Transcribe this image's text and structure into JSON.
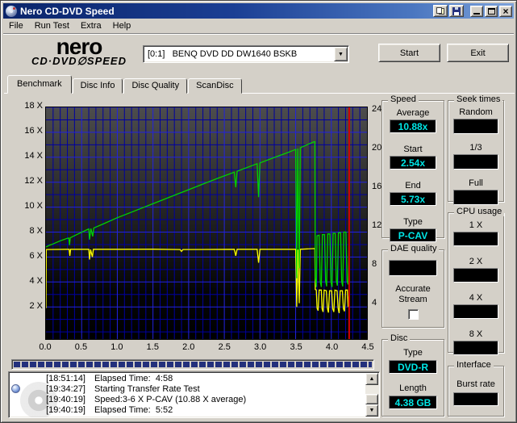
{
  "window": {
    "title": "Nero CD-DVD Speed"
  },
  "titlebar": {
    "report_button": "report-icon",
    "save_button": "save-icon",
    "minimize": "minimize",
    "maximize": "maximize",
    "close": "close"
  },
  "menu": {
    "items": [
      "File",
      "Run Test",
      "Extra",
      "Help"
    ]
  },
  "header": {
    "logo_line1": "nero",
    "logo_line2": "CD·DVD∅SPEED",
    "drive_select_value": "[0:1]   BENQ DVD DD DW1640 BSKB",
    "start_label": "Start",
    "exit_label": "Exit"
  },
  "tabs": [
    {
      "label": "Benchmark",
      "active": true
    },
    {
      "label": "Disc Info",
      "active": false
    },
    {
      "label": "Disc Quality",
      "active": false
    },
    {
      "label": "ScanDisc",
      "active": false
    }
  ],
  "chart_data": {
    "type": "line",
    "title": "Transfer rate benchmark",
    "x_unit": "GB",
    "x_range": [
      0,
      4.5
    ],
    "x_tick_labels": [
      "0.0",
      "0.5",
      "1.0",
      "1.5",
      "2.0",
      "2.5",
      "3.0",
      "3.5",
      "4.0",
      "4.5"
    ],
    "left_axis": {
      "unit": "X",
      "ticks": [
        18,
        16,
        14,
        12,
        10,
        8,
        6,
        4,
        2
      ],
      "top_value": 18
    },
    "right_axis": {
      "ticks": [
        24,
        20,
        16,
        12,
        8,
        4
      ],
      "top_value": 24
    },
    "grid": {
      "minor_x_step": 0.1,
      "major_x_step": 0.5,
      "minor_y_step": 1,
      "major_y_step": 2,
      "minor_color": "#0000a0",
      "major_color": "#2222e0"
    },
    "end_marker_gb": 4.25,
    "end_marker_color": "#d40000",
    "series": [
      {
        "name": "read_speed",
        "color": "#00d300",
        "axis": "left",
        "points": [
          [
            0.0,
            6.8
          ],
          [
            0.05,
            6.95
          ],
          [
            0.1,
            7.05
          ],
          [
            0.15,
            7.18
          ],
          [
            0.2,
            7.3
          ],
          [
            0.25,
            7.4
          ],
          [
            0.3,
            7.5
          ],
          [
            0.32,
            7.52
          ],
          [
            0.33,
            6.95
          ],
          [
            0.34,
            7.55
          ],
          [
            0.45,
            7.85
          ],
          [
            0.58,
            8.2
          ],
          [
            0.6,
            8.25
          ],
          [
            0.61,
            7.4
          ],
          [
            0.63,
            8.28
          ],
          [
            0.655,
            7.65
          ],
          [
            0.67,
            8.33
          ],
          [
            0.8,
            8.65
          ],
          [
            1.0,
            9.15
          ],
          [
            1.2,
            9.6
          ],
          [
            1.4,
            10.05
          ],
          [
            1.6,
            10.5
          ],
          [
            1.8,
            10.95
          ],
          [
            2.0,
            11.4
          ],
          [
            2.2,
            11.85
          ],
          [
            2.4,
            12.3
          ],
          [
            2.64,
            12.8
          ],
          [
            2.66,
            11.6
          ],
          [
            2.68,
            12.88
          ],
          [
            2.9,
            13.35
          ],
          [
            2.96,
            13.48
          ],
          [
            2.98,
            10.8
          ],
          [
            3.0,
            13.55
          ],
          [
            3.2,
            13.98
          ],
          [
            3.4,
            14.4
          ],
          [
            3.48,
            14.58
          ],
          [
            3.5,
            14.62
          ],
          [
            3.515,
            4.3
          ],
          [
            3.53,
            14.7
          ],
          [
            3.55,
            5.1
          ],
          [
            3.565,
            14.75
          ],
          [
            3.6,
            14.85
          ],
          [
            3.7,
            15.1
          ],
          [
            3.76,
            15.25
          ],
          [
            3.77,
            15.25
          ],
          [
            3.775,
            4.3
          ],
          [
            3.79,
            3.6
          ],
          [
            3.8,
            7.7
          ],
          [
            3.83,
            7.75
          ],
          [
            3.845,
            4.0
          ],
          [
            3.86,
            3.6
          ],
          [
            3.875,
            7.8
          ],
          [
            3.905,
            7.8
          ],
          [
            3.92,
            4.1
          ],
          [
            3.935,
            3.65
          ],
          [
            3.95,
            7.85
          ],
          [
            3.98,
            7.85
          ],
          [
            3.995,
            4.0
          ],
          [
            4.01,
            3.6
          ],
          [
            4.025,
            7.9
          ],
          [
            4.055,
            7.9
          ],
          [
            4.07,
            4.1
          ],
          [
            4.085,
            3.7
          ],
          [
            4.1,
            7.95
          ],
          [
            4.13,
            7.95
          ],
          [
            4.145,
            4.05
          ],
          [
            4.16,
            3.65
          ],
          [
            4.175,
            8.0
          ],
          [
            4.205,
            8.0
          ],
          [
            4.22,
            4.1
          ],
          [
            4.235,
            3.8
          ],
          [
            4.25,
            8.05
          ]
        ]
      },
      {
        "name": "rotation_speed",
        "color": "#ffff00",
        "axis": "left",
        "points": [
          [
            0.0,
            1.9
          ],
          [
            0.005,
            6.6
          ],
          [
            0.3,
            6.62
          ],
          [
            0.325,
            6.62
          ],
          [
            0.335,
            6.1
          ],
          [
            0.345,
            6.62
          ],
          [
            0.6,
            6.62
          ],
          [
            0.61,
            5.8
          ],
          [
            0.625,
            6.6
          ],
          [
            0.65,
            6.0
          ],
          [
            0.665,
            6.62
          ],
          [
            1.0,
            6.62
          ],
          [
            1.5,
            6.63
          ],
          [
            1.88,
            6.6
          ],
          [
            1.9,
            6.45
          ],
          [
            1.92,
            6.6
          ],
          [
            2.64,
            6.62
          ],
          [
            2.66,
            6.1
          ],
          [
            2.68,
            6.62
          ],
          [
            2.96,
            6.62
          ],
          [
            2.98,
            5.55
          ],
          [
            3.0,
            6.62
          ],
          [
            3.5,
            6.62
          ],
          [
            3.515,
            2.0
          ],
          [
            3.53,
            6.6
          ],
          [
            3.55,
            2.3
          ],
          [
            3.565,
            6.62
          ],
          [
            3.77,
            6.68
          ],
          [
            3.775,
            3.4
          ],
          [
            3.79,
            3.35
          ],
          [
            3.8,
            1.9
          ],
          [
            3.815,
            1.7
          ],
          [
            3.83,
            3.35
          ],
          [
            3.86,
            3.35
          ],
          [
            3.87,
            1.85
          ],
          [
            3.885,
            1.6
          ],
          [
            3.9,
            3.35
          ],
          [
            3.93,
            3.3
          ],
          [
            3.945,
            1.9
          ],
          [
            3.96,
            1.55
          ],
          [
            3.975,
            3.3
          ],
          [
            4.005,
            3.3
          ],
          [
            4.02,
            1.85
          ],
          [
            4.035,
            1.6
          ],
          [
            4.05,
            3.35
          ],
          [
            4.08,
            3.3
          ],
          [
            4.095,
            1.9
          ],
          [
            4.11,
            1.5
          ],
          [
            4.125,
            3.3
          ],
          [
            4.155,
            3.3
          ],
          [
            4.17,
            1.85
          ],
          [
            4.185,
            1.65
          ],
          [
            4.2,
            3.35
          ],
          [
            4.225,
            3.35
          ],
          [
            4.235,
            2.0
          ],
          [
            4.25,
            3.2
          ]
        ]
      }
    ]
  },
  "panels": {
    "speed": {
      "title": "Speed",
      "fields": [
        {
          "label": "Average",
          "value": "10.88x"
        },
        {
          "label": "Start",
          "value": "2.54x"
        },
        {
          "label": "End",
          "value": "5.73x"
        },
        {
          "label": "Type",
          "value": "P-CAV"
        }
      ]
    },
    "seek_times": {
      "title": "Seek times",
      "fields": [
        {
          "label": "Random",
          "value": ""
        },
        {
          "label": "1/3",
          "value": ""
        },
        {
          "label": "Full",
          "value": ""
        }
      ]
    },
    "cpu_usage": {
      "title": "CPU usage",
      "fields": [
        {
          "label": "1 X",
          "value": ""
        },
        {
          "label": "2 X",
          "value": ""
        },
        {
          "label": "4 X",
          "value": ""
        },
        {
          "label": "8 X",
          "value": ""
        }
      ]
    },
    "dae_quality": {
      "title": "DAE quality",
      "value": "",
      "checkbox_label_line1": "Accurate",
      "checkbox_label_line2": "Stream",
      "checkbox_checked": false
    },
    "disc": {
      "title": "Disc",
      "fields": [
        {
          "label": "Type",
          "value": "DVD-R"
        },
        {
          "label": "Length",
          "value": "4.38 GB"
        }
      ]
    },
    "interface": {
      "title": "Interface",
      "fields": [
        {
          "label": "Burst rate",
          "value": ""
        }
      ]
    }
  },
  "progress": {
    "percent": 100
  },
  "log": {
    "rows": [
      {
        "time": "[18:51:14]",
        "text": "Elapsed Time:  4:58"
      },
      {
        "time": "[19:34:27]",
        "text": "Starting Transfer Rate Test"
      },
      {
        "time": "[19:40:19]",
        "text": "Speed:3-6 X P-CAV (10.88 X average)"
      },
      {
        "time": "[19:40:19]",
        "text": "Elapsed Time:  5:52"
      }
    ]
  }
}
